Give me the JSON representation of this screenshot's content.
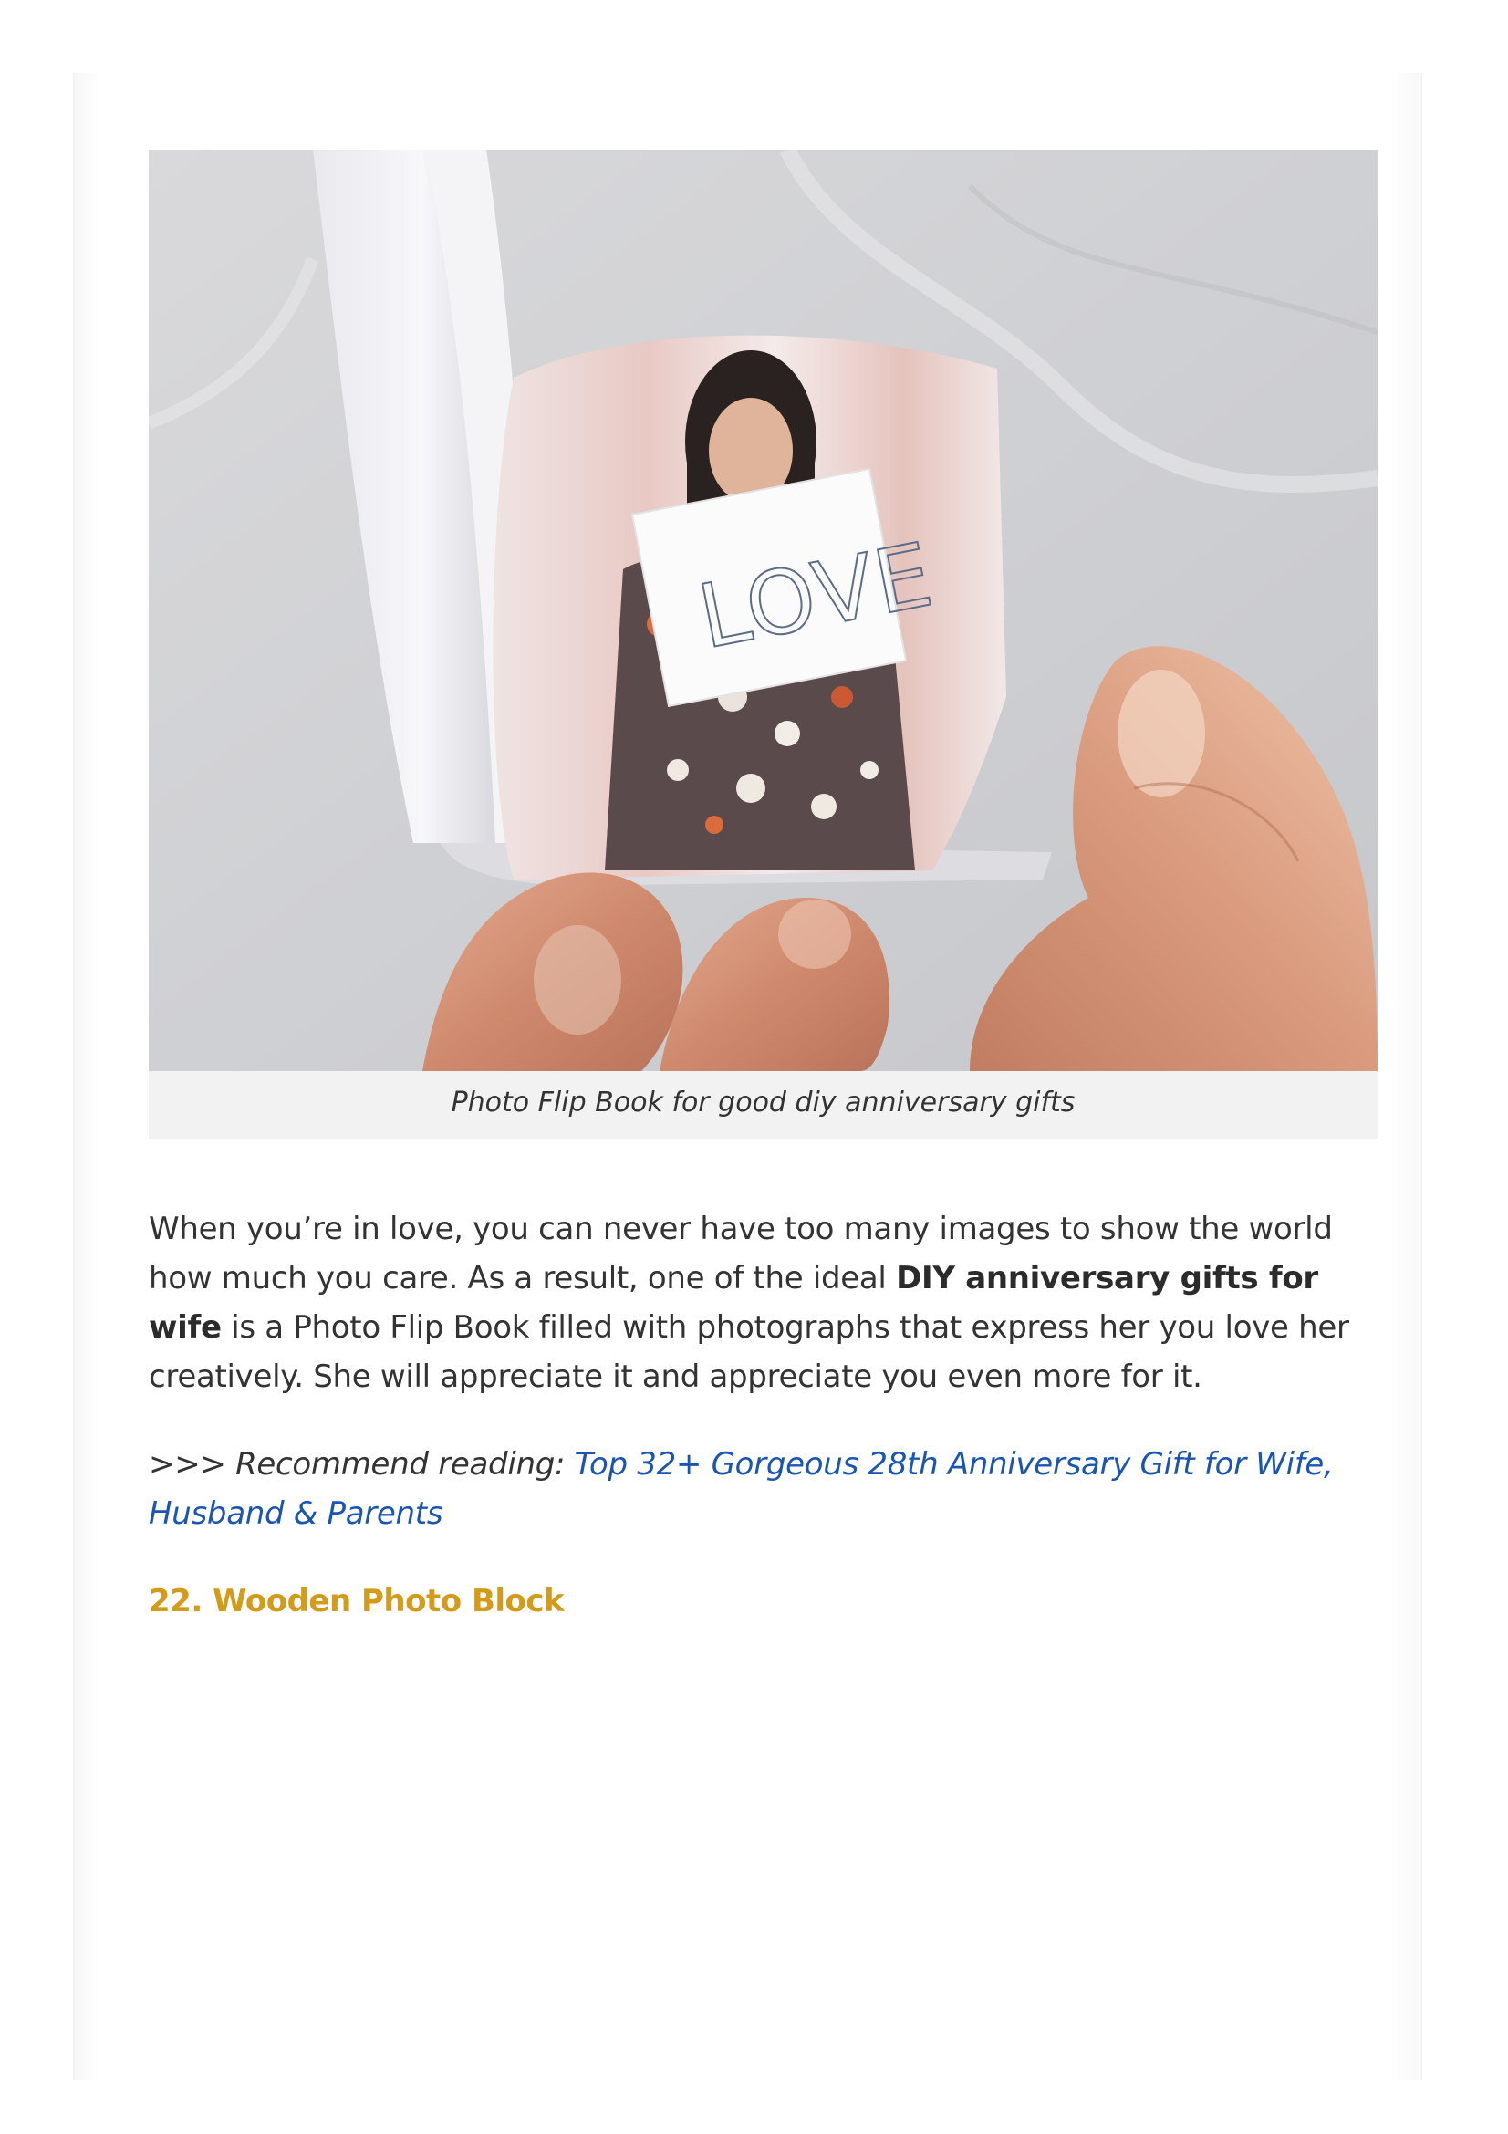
{
  "figure": {
    "image_alt": "Hands holding a photo flip book showing a woman holding a LOVE sign",
    "sign_text": "LOVE",
    "caption": "Photo Flip Book for good diy anniversary gifts"
  },
  "paragraph": {
    "part1": "When you’re in love, you can never have too many images to show the world how much you care. As a result, one of the ideal ",
    "bold": "DIY anniversary gifts for wife",
    "part2": " is a Photo Flip Book filled with photographs that express her you love her creatively. She will appreciate it and appreciate you even more for it."
  },
  "recommend": {
    "prefix": ">>> Recommend reading: ",
    "link_text": "Top 32+ Gorgeous 28th Anniversary Gift for Wife, Husband & Parents"
  },
  "next_section": {
    "heading": "22. Wooden Photo Block"
  },
  "colors": {
    "link": "#1a55b5",
    "heading": "#d49a1a",
    "caption_bg": "#f2f2f2",
    "text": "#333333"
  }
}
